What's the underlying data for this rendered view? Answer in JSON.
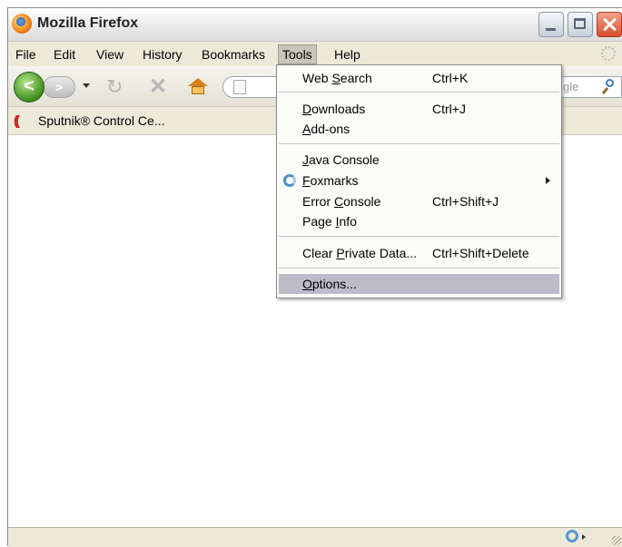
{
  "window": {
    "title": "Mozilla Firefox",
    "buttons": [
      "minimize",
      "maximize",
      "close"
    ]
  },
  "menubar": {
    "items": [
      "File",
      "Edit",
      "View",
      "History",
      "Bookmarks",
      "Tools",
      "Help"
    ],
    "active": "Tools"
  },
  "navbar": {
    "back_label": "<",
    "forward_label": ">",
    "search_placeholder": "gle"
  },
  "bookmarks": {
    "items": [
      {
        "label": "Sputnik® Control Ce...",
        "icon": "sputnik-icon"
      }
    ]
  },
  "tools_menu": {
    "web_search": {
      "label": "Web Search",
      "shortcut": "Ctrl+K"
    },
    "downloads": {
      "label": "Downloads",
      "shortcut": "Ctrl+J"
    },
    "addons": {
      "label": "Add-ons"
    },
    "java_console": {
      "label": "Java Console"
    },
    "foxmarks": {
      "label": "Foxmarks",
      "icon": "foxmarks-icon",
      "has_submenu": true
    },
    "error_console": {
      "label": "Error Console",
      "shortcut": "Ctrl+Shift+J"
    },
    "page_info": {
      "label": "Page Info"
    },
    "clear_private": {
      "label": "Clear Private Data...",
      "shortcut": "Ctrl+Shift+Delete"
    },
    "options": {
      "label": "Options...",
      "highlighted": true
    }
  },
  "colors": {
    "menu_highlight": "#bdbbc8",
    "chrome": "#ece9d8",
    "back_button": "#3e8e1d",
    "close_button": "#d94d2d"
  }
}
